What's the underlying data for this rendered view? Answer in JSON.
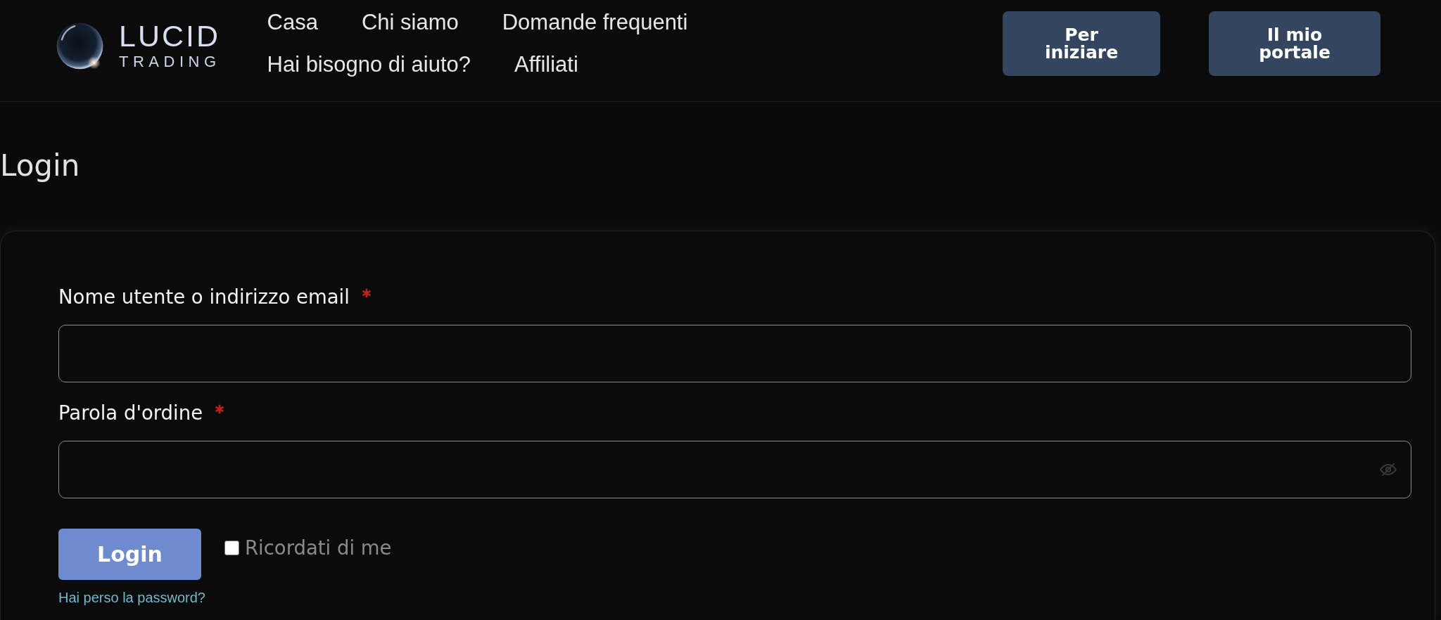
{
  "header": {
    "logo": {
      "name": "LUCID",
      "tagline": "TRADING"
    },
    "nav": [
      "Casa",
      "Chi siamo",
      "Domande frequenti",
      "Hai bisogno di aiuto?",
      "Affiliati"
    ],
    "buttons": [
      "Per iniziare",
      "Il mio portale"
    ]
  },
  "page": {
    "title": "Login"
  },
  "login_form": {
    "fields": [
      {
        "kind": "text",
        "label": "Nome utente o indirizzo email",
        "required": true
      },
      {
        "kind": "password",
        "label": "Parola d'ordine",
        "required": true
      }
    ],
    "submit": {
      "label": "Login"
    },
    "remember_me": {
      "label": "Ricordati di me",
      "checked": false
    },
    "lost_password": {
      "label": "Hai perso la password?"
    }
  }
}
